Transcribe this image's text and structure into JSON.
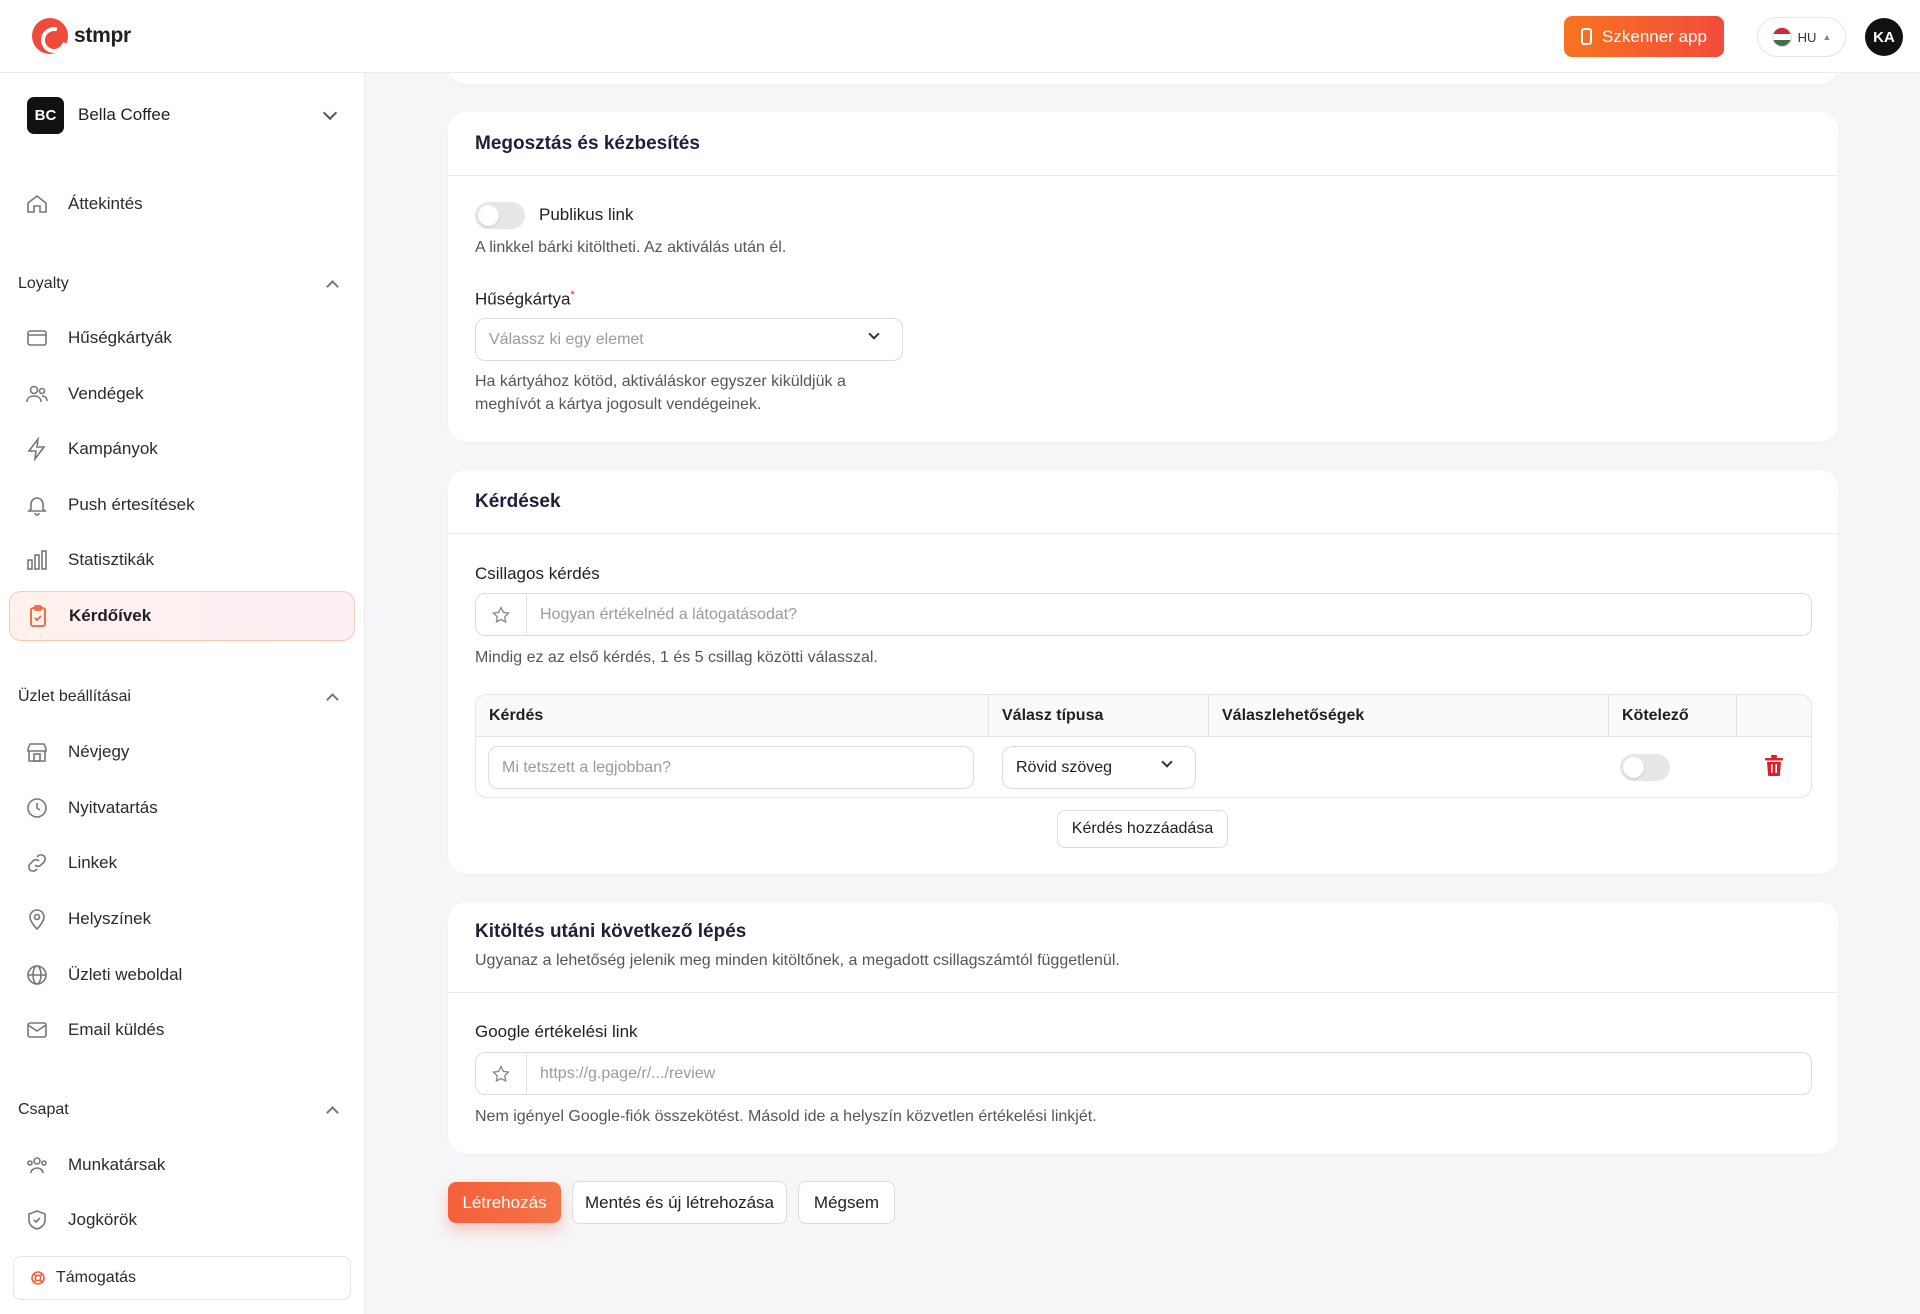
{
  "header": {
    "logo_text": "stmpr",
    "scanner_label": "Szkenner app",
    "lang_code": "HU",
    "avatar_initials": "KA"
  },
  "sidebar": {
    "org_initials": "BC",
    "org_name": "Bella Coffee",
    "overview": "Áttekintés",
    "loyalty_label": "Loyalty",
    "loyalty_items": [
      "Hűségkártyák",
      "Vendégek",
      "Kampányok",
      "Push értesítések",
      "Statisztikák",
      "Kérdőívek"
    ],
    "shop_label": "Üzlet beállításai",
    "shop_items": [
      "Névjegy",
      "Nyitvatartás",
      "Linkek",
      "Helyszínek",
      "Üzleti weboldal",
      "Email küldés"
    ],
    "team_label": "Csapat",
    "team_items": [
      "Munkatársak",
      "Jogkörök"
    ],
    "support": "Támogatás"
  },
  "sharing": {
    "title": "Megosztás és kézbesítés",
    "public_link_label": "Publikus link",
    "public_link_hint": "A linkkel bárki kitöltheti. Az aktiválás után él.",
    "card_label": "Hűségkártya",
    "required_mark": "*",
    "card_placeholder": "Válassz ki egy elemet",
    "card_hint_1": "Ha kártyához kötöd, aktiváláskor egyszer kiküldjük a",
    "card_hint_2": "meghívót a kártya jogosult vendégeinek."
  },
  "questions": {
    "title": "Kérdések",
    "star_label": "Csillagos kérdés",
    "star_placeholder": "Hogyan értékelnéd a látogatásodat?",
    "star_hint": "Mindig ez az első kérdés, 1 és 5 csillag közötti válasszal.",
    "columns": [
      "Kérdés",
      "Válasz típusa",
      "Válaszlehetőségek",
      "Kötelező"
    ],
    "row_placeholder": "Mi tetszett a legjobban?",
    "row_type": "Rövid szöveg",
    "add_label": "Kérdés hozzáadása"
  },
  "next_step": {
    "title": "Kitöltés utáni következő lépés",
    "subtitle": "Ugyanaz a lehetőség jelenik meg minden kitöltőnek, a megadott csillagszámtól függetlenül.",
    "google_label": "Google értékelési link",
    "google_placeholder": "https://g.page/r/.../review",
    "google_hint": "Nem igényel Google-fiók összekötést. Másold ide a helyszín közvetlen értékelési linkjét."
  },
  "actions": {
    "create": "Létrehozás",
    "save_new": "Mentés és új létrehozása",
    "cancel": "Mégsem"
  },
  "colors": {
    "accent": "#f4603a",
    "danger": "#e11d2a"
  }
}
